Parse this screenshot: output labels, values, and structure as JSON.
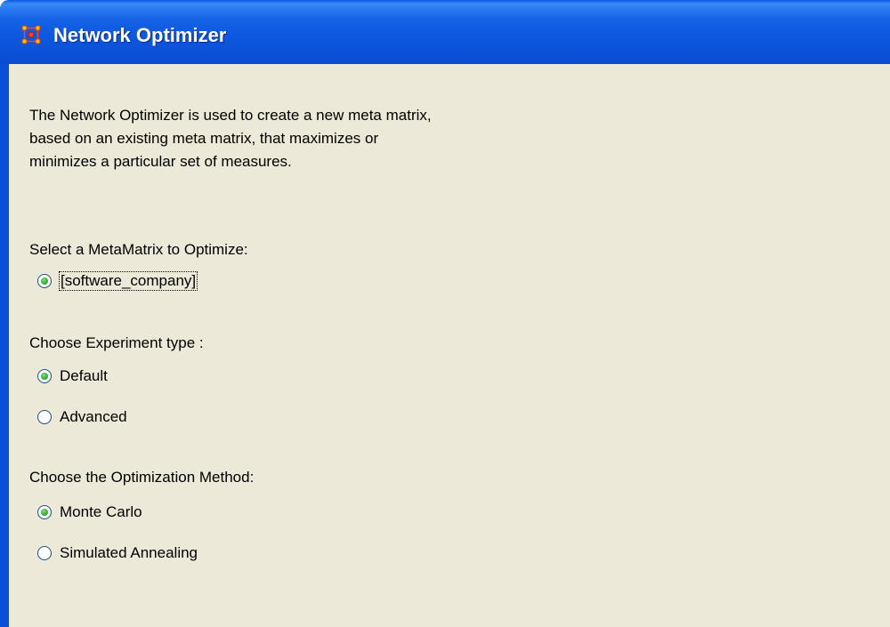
{
  "window": {
    "title": "Network Optimizer",
    "icon": "network-app-icon",
    "colors": {
      "titlebar": "#0b52d8",
      "client_background": "#ece9d8",
      "radio_selected": "#3bb33b"
    }
  },
  "description": {
    "lines": [
      "The Network Optimizer is used to create a new meta matrix,",
      "based on an existing meta matrix, that maximizes or",
      "minimizes a particular set of measures."
    ]
  },
  "metamatrix_group": {
    "label": "Select a MetaMatrix to Optimize:",
    "options": [
      {
        "label": "[software_company]",
        "selected": true
      }
    ]
  },
  "experiment_group": {
    "label": "Choose Experiment type :",
    "options": [
      {
        "label": "Default",
        "selected": true
      },
      {
        "label": "Advanced",
        "selected": false
      }
    ]
  },
  "method_group": {
    "label": "Choose the Optimization Method:",
    "options": [
      {
        "label": "Monte Carlo",
        "selected": true
      },
      {
        "label": "Simulated Annealing",
        "selected": false
      }
    ]
  }
}
